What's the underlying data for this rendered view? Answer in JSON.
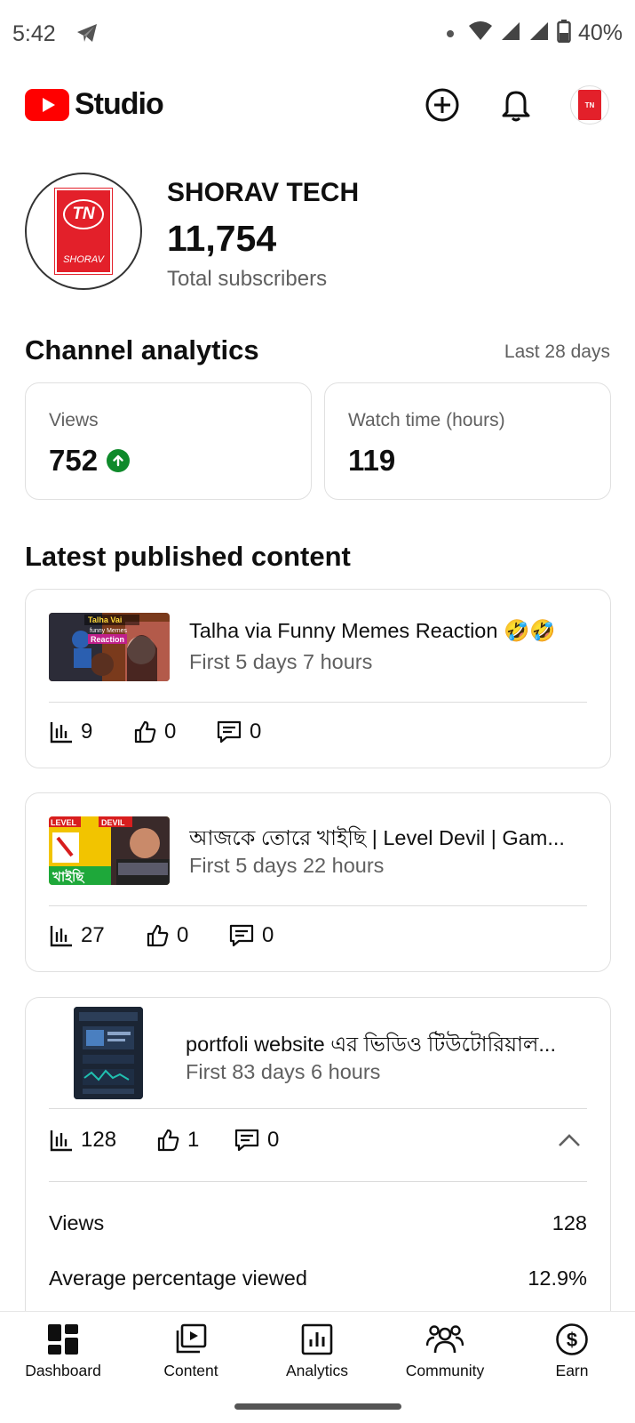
{
  "status_bar": {
    "time": "5:42",
    "battery": "40%",
    "icons": [
      "telegram-icon",
      "dot-icon",
      "wifi-icon",
      "signal-icon",
      "signal-icon",
      "battery-icon"
    ]
  },
  "app_bar": {
    "logo_text": "Studio",
    "brand_color": "#ff0000",
    "actions": [
      "create-icon",
      "bell-icon",
      "avatar"
    ],
    "avatar_text": "TN"
  },
  "channel": {
    "name": "SHORAV TECH",
    "subscribers": "11,754",
    "subscribers_label": "Total subscribers",
    "logo_initials": "TN",
    "logo_caption": "SHORAV"
  },
  "analytics": {
    "title": "Channel analytics",
    "period": "Last 28 days",
    "cards": [
      {
        "label": "Views",
        "value": "752",
        "trend": "up",
        "trend_color": "#0f8a2b"
      },
      {
        "label": "Watch time (hours)",
        "value": "119"
      }
    ]
  },
  "latest": {
    "title": "Latest published content",
    "items": [
      {
        "title": "Talha via Funny Memes Reaction 🤣🤣",
        "subtitle": "First 5 days 7 hours",
        "views": "9",
        "likes": "0",
        "comments": "0",
        "thumb_text": "Talha Vai funny Memes Reaction"
      },
      {
        "title": "আজকে তোরে খাইছি | Level Devil | Gam...",
        "subtitle": "First 5 days 22 hours",
        "views": "27",
        "likes": "0",
        "comments": "0",
        "thumb_text": "LEVEL DEVIL খাইছি"
      },
      {
        "title": "portfoli website এর ভিডিও টিউটোরিয়াল...",
        "subtitle": "First 83 days 6 hours",
        "views": "128",
        "likes": "1",
        "comments": "0",
        "expanded": true,
        "details": [
          {
            "label": "Views",
            "value": "128"
          },
          {
            "label": "Average percentage viewed",
            "value": "12.9%"
          }
        ]
      }
    ]
  },
  "bottom_nav": [
    {
      "label": "Dashboard",
      "icon": "dashboard-icon",
      "active": true
    },
    {
      "label": "Content",
      "icon": "content-icon"
    },
    {
      "label": "Analytics",
      "icon": "analytics-icon"
    },
    {
      "label": "Community",
      "icon": "community-icon"
    },
    {
      "label": "Earn",
      "icon": "earn-icon"
    }
  ]
}
